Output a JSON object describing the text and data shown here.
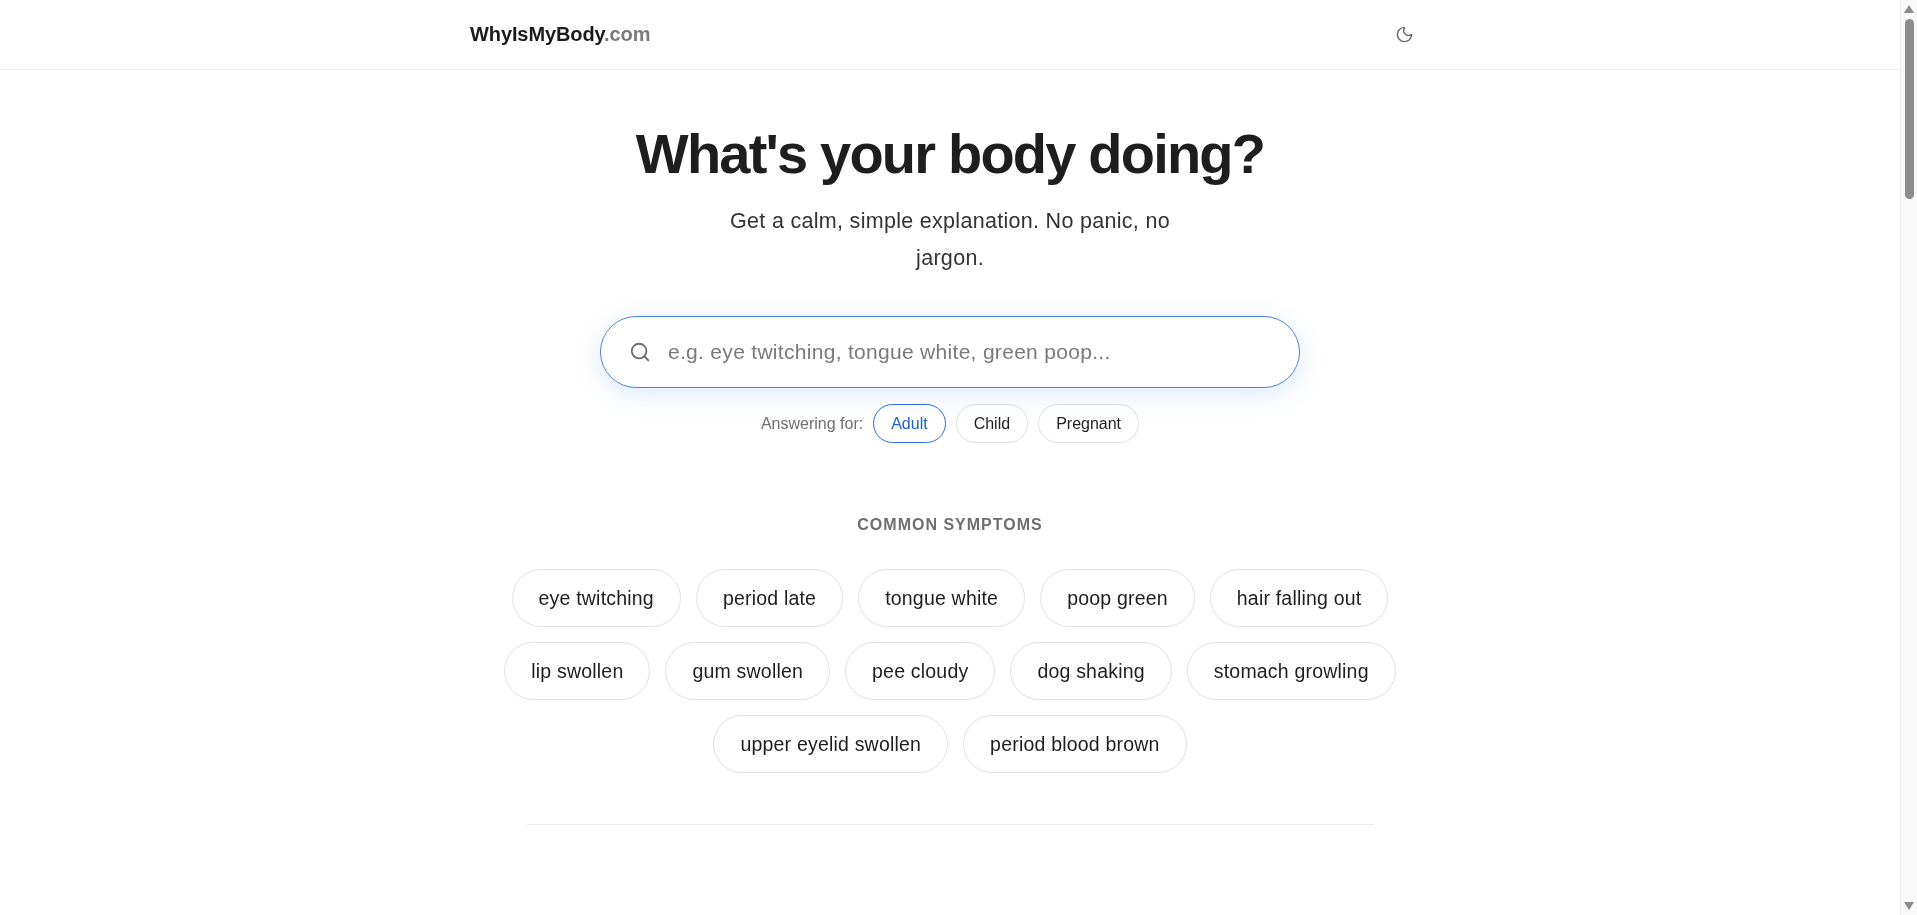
{
  "header": {
    "brand": {
      "name": "WhyIsMyBody",
      "domain": ".com"
    }
  },
  "hero": {
    "title": "What's your body doing?",
    "subtitle": "Get a calm, simple explanation. No panic, no jargon."
  },
  "search": {
    "placeholder": "e.g. eye twitching, tongue white, green poop..."
  },
  "audience": {
    "label": "Answering for:",
    "options": [
      {
        "label": "Adult",
        "selected": true
      },
      {
        "label": "Child",
        "selected": false
      },
      {
        "label": "Pregnant",
        "selected": false
      }
    ]
  },
  "common_symptoms": {
    "heading": "COMMON SYMPTOMS",
    "items": [
      "eye twitching",
      "period late",
      "tongue white",
      "poop green",
      "hair falling out",
      "lip swollen",
      "gum swollen",
      "pee cloudy",
      "dog shaking",
      "stomach growling",
      "upper eyelid swollen",
      "period blood brown"
    ]
  }
}
